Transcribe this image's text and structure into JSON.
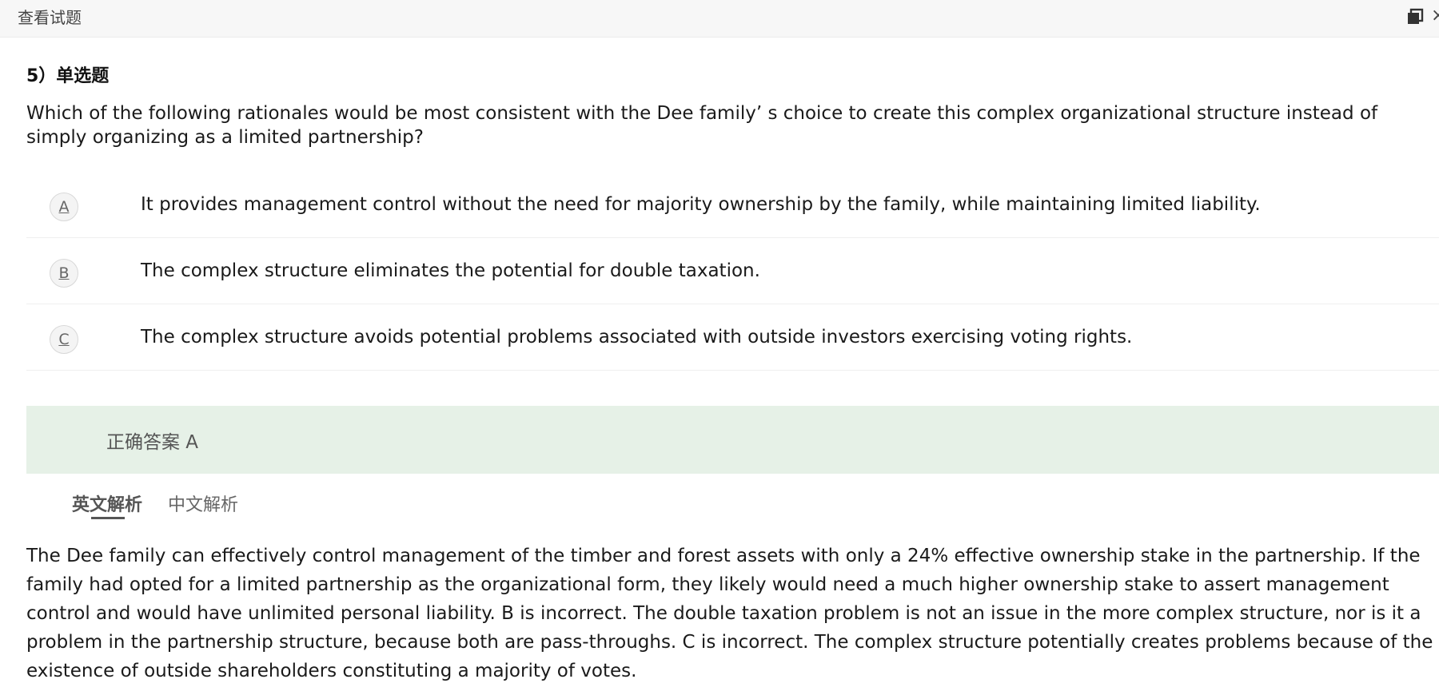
{
  "window": {
    "title": "查看试题",
    "restore_icon": "restore-window-icon",
    "close_label": "×"
  },
  "question": {
    "header": "5）单选题",
    "text": "Which of the following rationales would be most consistent with the Dee family’ s choice to create this complex organizational structure instead of simply organizing as a limited partnership?",
    "options": [
      {
        "letter": "A",
        "text": "It provides management control without the need for majority ownership by the family, while maintaining limited liability."
      },
      {
        "letter": "B",
        "text": "The complex structure eliminates the potential for double taxation."
      },
      {
        "letter": "C",
        "text": "The complex structure avoids potential problems associated with outside investors exercising voting rights."
      }
    ]
  },
  "answer": {
    "label": "正确答案 A"
  },
  "tabs": [
    {
      "label": "英文解析",
      "active": true
    },
    {
      "label": "中文解析",
      "active": false
    }
  ],
  "explanation": {
    "text": "The Dee family can effectively control management of the timber and forest assets with only a 24% effective ownership stake in the partnership. If the family had opted for a limited partnership as the organizational form, they likely would need a much higher ownership stake to assert management control and would have unlimited personal liability. B is incorrect. The double taxation problem is not an issue in the more complex structure, nor is it a problem in the partnership structure, because both are pass-throughs. C is incorrect. The complex structure potentially creates problems because of the existence of outside shareholders constituting a majority of votes."
  },
  "colors": {
    "answer_bg": "#e6f1e7",
    "titlebar_bg": "#f7f7f7"
  }
}
